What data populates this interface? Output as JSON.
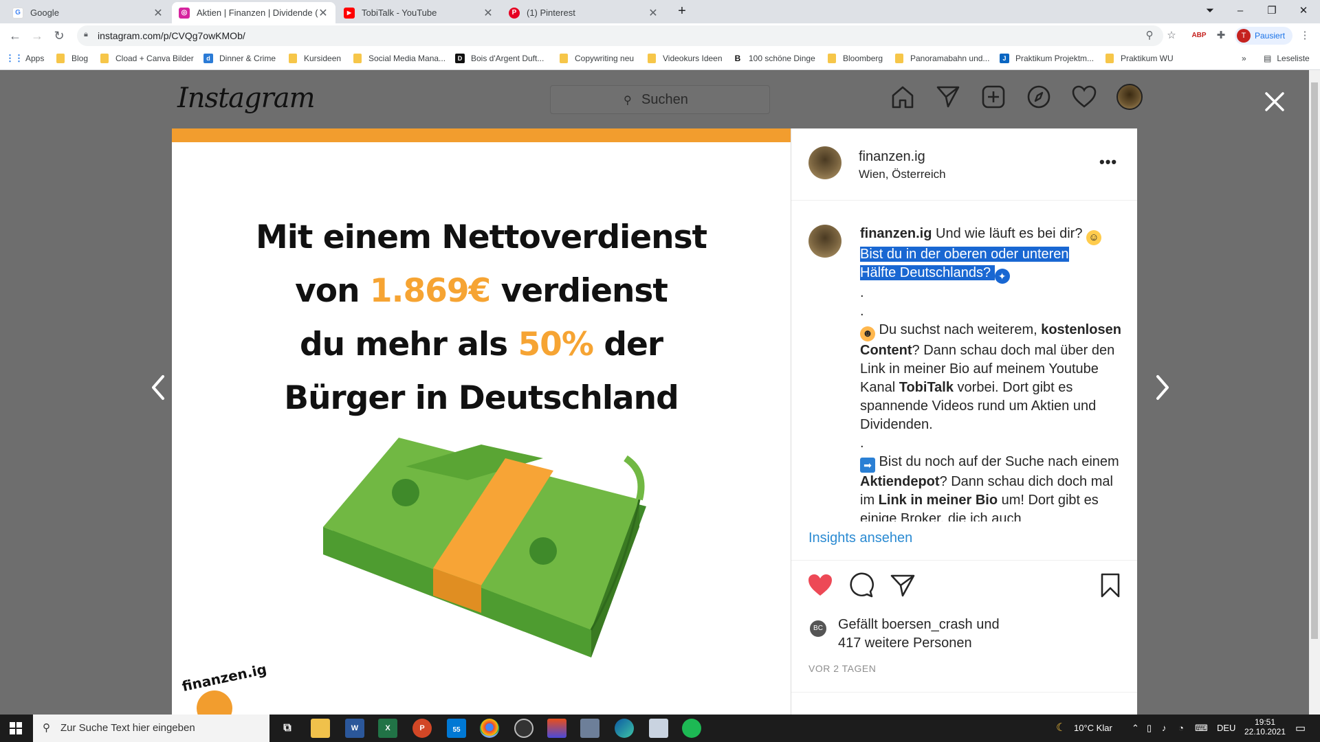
{
  "browser": {
    "tabs": [
      {
        "title": "Google",
        "favicon_color": "#4285f4",
        "favicon_letter": "G"
      },
      {
        "title": "Aktien | Finanzen | Dividende (@",
        "favicon_color": "#d6249f",
        "favicon_letter": "◎"
      },
      {
        "title": "TobiTalk - YouTube",
        "favicon_color": "#ff0000",
        "favicon_letter": "▶"
      },
      {
        "title": "(1) Pinterest",
        "favicon_color": "#e60023",
        "favicon_letter": "P"
      }
    ],
    "url": "instagram.com/p/CVQg7owKMOb/",
    "profile_initial": "T",
    "profile_label": "Pausiert",
    "bookmarks": [
      {
        "label": "Apps"
      },
      {
        "label": "Blog"
      },
      {
        "label": "Cload + Canva Bilder"
      },
      {
        "label": "Dinner & Crime"
      },
      {
        "label": "Kursideen"
      },
      {
        "label": "Social Media Mana..."
      },
      {
        "label": "Bois d'Argent Duft..."
      },
      {
        "label": "Copywriting neu"
      },
      {
        "label": "Videokurs Ideen"
      },
      {
        "label": "100 schöne Dinge"
      },
      {
        "label": "Bloomberg"
      },
      {
        "label": "Panoramabahn und..."
      },
      {
        "label": "Praktikum Projektm..."
      },
      {
        "label": "Praktikum WU"
      }
    ],
    "reading_list": "Leseliste"
  },
  "instagram": {
    "logo": "Instagram",
    "search_placeholder": "Suchen"
  },
  "post_image": {
    "line1": "Mit einem Nettoverdienst",
    "line2_pre": "von ",
    "line2_hl": "1.869€",
    "line2_post": " verdienst",
    "line3_pre": "du mehr als ",
    "line3_hl": "50%",
    "line3_post": " der",
    "line4": "Bürger in Deutschland",
    "stamp": "finanzen.ig",
    "accent_color": "#f6a433"
  },
  "panel": {
    "username": "finanzen.ig",
    "location": "Wien, Österreich",
    "caption": {
      "user": "finanzen.ig",
      "intro": " Und wie läuft es bei dir? ",
      "selected_1": "Bist du in der oberen oder unteren",
      "selected_2": "Hälfte Deutschlands? ",
      "dot": ".",
      "p1_a": " Du suchst nach weiterem, ",
      "p1_b": "kostenlosen Content",
      "p1_c": "? Dann schau doch mal über den Link in meiner Bio auf meinem Youtube Kanal ",
      "p1_d": "TobiTalk",
      "p1_e": " vorbei. Dort gibt es spannende Videos rund um Aktien und Dividenden.",
      "p2_a": " Bist du noch auf der Suche nach einem ",
      "p2_b": "Aktiendepot",
      "p2_c": "? Dann schau dich doch mal im ",
      "p2_d": "Link in meiner Bio",
      "p2_e": " um! Dort gibt es einige Broker, die ich auch"
    },
    "insights": "Insights ansehen",
    "likes_pre": "Gefällt ",
    "likes_user": "boersen_crash",
    "likes_mid": " und",
    "likes_count": "417 weitere Personen",
    "time_ago": "VOR 2 TAGEN",
    "like_color": "#ed4956"
  },
  "taskbar": {
    "search_placeholder": "Zur Suche Text hier eingeben",
    "weather": "10°C  Klar",
    "language": "DEU",
    "time": "19:51",
    "date": "22.10.2021",
    "mail_badge": "55"
  }
}
